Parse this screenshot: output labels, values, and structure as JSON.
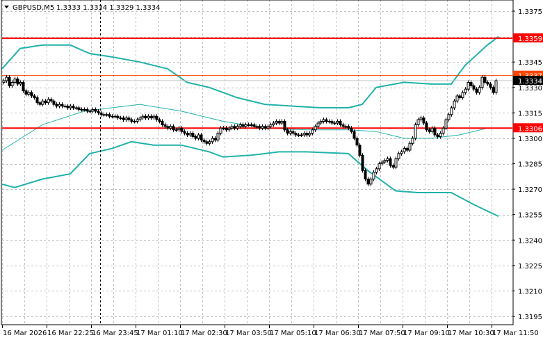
{
  "header": {
    "symbol": "GBPUSD,M5",
    "ohlc_text": "1.3333 1.3334 1.3329 1.3334",
    "menu_icon": "triangle-down-icon"
  },
  "colors": {
    "background": "#ffffff",
    "grid": "#c0c0c0",
    "bands": "#20b2aa",
    "level_line": "#ff0000",
    "ask_line": "#ff4500",
    "bid_line": "#c0c0c0",
    "bull_body": "#ffffff",
    "bear_body": "#000000"
  },
  "chart_data": {
    "type": "candlestick",
    "title": "GBPUSD,M5",
    "timeframe_minutes": 5,
    "ylim": [
      1.319,
      1.3382
    ],
    "grid": true,
    "y_ticks": [
      "1.3375",
      "1.3345",
      "1.3330",
      "1.3315",
      "1.3300",
      "1.3285",
      "1.3270",
      "1.3255",
      "1.3240",
      "1.3225",
      "1.3210",
      "1.3195"
    ],
    "x_ticks": [
      "16 Mar 2026",
      "16 Mar 22:25",
      "16 Mar 23:45",
      "17 Mar 01:10",
      "17 Mar 02:30",
      "17 Mar 03:50",
      "17 Mar 05:10",
      "17 Mar 06:30",
      "17 Mar 07:50",
      "17 Mar 09:10",
      "17 Mar 10:30",
      "17 Mar 11:50"
    ],
    "first_open": 1.3333,
    "closes": [
      1.3334,
      1.3336,
      1.3331,
      1.3333,
      1.3335,
      1.3332,
      1.3333,
      1.3328,
      1.3326,
      1.3327,
      1.3325,
      1.3324,
      1.3321,
      1.332,
      1.3322,
      1.3321,
      1.3323,
      1.3322,
      1.332,
      1.3319,
      1.332,
      1.3319,
      1.3319,
      1.3318,
      1.3319,
      1.3318,
      1.3318,
      1.3317,
      1.3317,
      1.3317,
      1.3316,
      1.3316,
      1.3317,
      1.3316,
      1.3315,
      1.3314,
      1.3314,
      1.3314,
      1.3313,
      1.3313,
      1.3313,
      1.3312,
      1.3312,
      1.3311,
      1.3312,
      1.3311,
      1.331,
      1.331,
      1.3311,
      1.3312,
      1.3313,
      1.3312,
      1.3313,
      1.3312,
      1.3313,
      1.3311,
      1.331,
      1.3308,
      1.3307,
      1.3306,
      1.3307,
      1.3305,
      1.3305,
      1.3306,
      1.3304,
      1.3303,
      1.3302,
      1.3303,
      1.3301,
      1.33,
      1.3302,
      1.3299,
      1.3298,
      1.3297,
      1.3298,
      1.33,
      1.3299,
      1.3303,
      1.3306,
      1.3306,
      1.3305,
      1.3306,
      1.3307,
      1.3306,
      1.3307,
      1.3308,
      1.3307,
      1.3308,
      1.3308,
      1.3308,
      1.3307,
      1.3307,
      1.3306,
      1.3307,
      1.3306,
      1.3307,
      1.3308,
      1.3309,
      1.331,
      1.3309,
      1.331,
      1.3305,
      1.3303,
      1.3304,
      1.3303,
      1.3302,
      1.3302,
      1.3302,
      1.3303,
      1.3302,
      1.3303,
      1.3305,
      1.3307,
      1.3309,
      1.331,
      1.3311,
      1.331,
      1.331,
      1.3309,
      1.3309,
      1.331,
      1.3308,
      1.3307,
      1.3307,
      1.3306,
      1.3304,
      1.33,
      1.3296,
      1.329,
      1.3281,
      1.3276,
      1.3273,
      1.3276,
      1.328,
      1.3282,
      1.3285,
      1.3286,
      1.3287,
      1.3288,
      1.3284,
      1.3283,
      1.3288,
      1.3291,
      1.3292,
      1.3294,
      1.3293,
      1.3297,
      1.33,
      1.3308,
      1.3311,
      1.3312,
      1.3309,
      1.3305,
      1.3304,
      1.3306,
      1.3302,
      1.3301,
      1.3303,
      1.3306,
      1.3311,
      1.3314,
      1.3318,
      1.3322,
      1.3325,
      1.3324,
      1.3327,
      1.3329,
      1.3333,
      1.3331,
      1.3329,
      1.3327,
      1.333,
      1.3336,
      1.3333,
      1.3332,
      1.333,
      1.3327,
      1.3334
    ],
    "bollinger": {
      "upper": [
        [
          -0.5,
          1.3341
        ],
        [
          6,
          1.3353
        ],
        [
          14,
          1.3355
        ],
        [
          24,
          1.3355
        ],
        [
          31,
          1.335
        ],
        [
          39,
          1.3348
        ],
        [
          49,
          1.3345
        ],
        [
          59,
          1.3341
        ],
        [
          66,
          1.3333
        ],
        [
          74,
          1.333
        ],
        [
          84,
          1.3324
        ],
        [
          94,
          1.332
        ],
        [
          104,
          1.3319
        ],
        [
          114,
          1.3318
        ],
        [
          124,
          1.3318
        ],
        [
          129,
          1.332
        ],
        [
          134,
          1.333
        ],
        [
          144,
          1.3333
        ],
        [
          154,
          1.3332
        ],
        [
          161,
          1.3332
        ],
        [
          166,
          1.3343
        ],
        [
          174,
          1.3355
        ],
        [
          178,
          1.336
        ]
      ],
      "middle": [
        [
          -0.5,
          1.3293
        ],
        [
          14,
          1.3308
        ],
        [
          29,
          1.3316
        ],
        [
          49,
          1.332
        ],
        [
          64,
          1.3316
        ],
        [
          79,
          1.331
        ],
        [
          94,
          1.3306
        ],
        [
          109,
          1.3305
        ],
        [
          124,
          1.3305
        ],
        [
          134,
          1.3304
        ],
        [
          144,
          1.33
        ],
        [
          154,
          1.33
        ],
        [
          164,
          1.3302
        ],
        [
          174,
          1.3306
        ],
        [
          176,
          1.3306
        ]
      ],
      "lower": [
        [
          -0.5,
          1.3273
        ],
        [
          4,
          1.3271
        ],
        [
          14,
          1.3276
        ],
        [
          24,
          1.3279
        ],
        [
          31,
          1.3291
        ],
        [
          39,
          1.3294
        ],
        [
          46,
          1.3298
        ],
        [
          54,
          1.3296
        ],
        [
          64,
          1.3296
        ],
        [
          74,
          1.3292
        ],
        [
          79,
          1.3289
        ],
        [
          89,
          1.329
        ],
        [
          99,
          1.3292
        ],
        [
          109,
          1.3292
        ],
        [
          124,
          1.3291
        ],
        [
          131,
          1.3281
        ],
        [
          141,
          1.3269
        ],
        [
          149,
          1.3268
        ],
        [
          161,
          1.3268
        ],
        [
          169,
          1.3261
        ],
        [
          178,
          1.3254
        ]
      ]
    },
    "levels": [
      {
        "price": 1.3359,
        "label": "1.3359",
        "kind": "support-resistance"
      },
      {
        "price": 1.3306,
        "label": "1.3306",
        "kind": "support-resistance"
      }
    ],
    "ask": {
      "price": 1.3337,
      "label": "1.3337"
    },
    "bid": {
      "price": 1.3334,
      "label": "1.3334"
    },
    "separator_time": "16 Mar 23:45"
  }
}
